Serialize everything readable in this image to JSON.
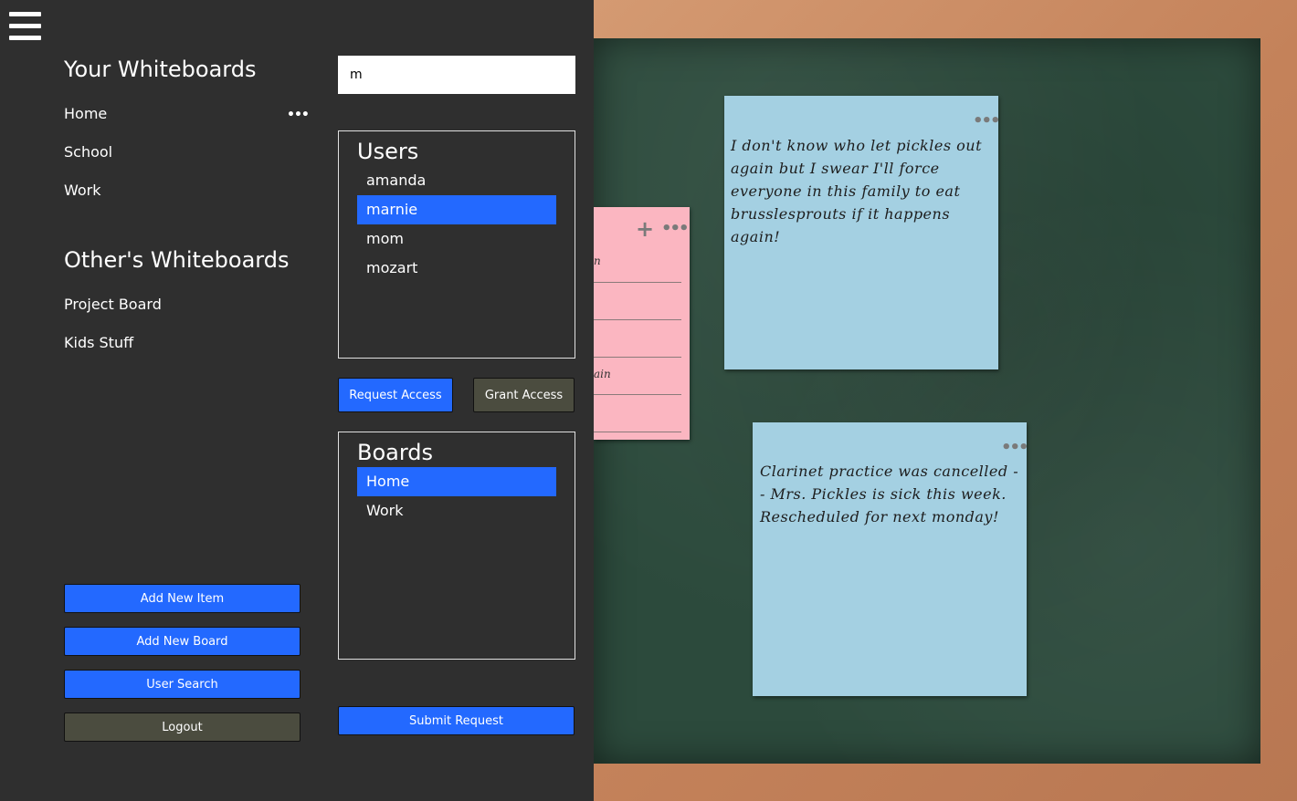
{
  "sidebar": {
    "your_title": "Your Whiteboards",
    "your_boards": [
      "Home",
      "School",
      "Work"
    ],
    "home_menu": "•••",
    "others_title": "Other's Whiteboards",
    "others_boards": [
      "Project Board",
      "Kids Stuff"
    ],
    "buttons": {
      "add_item": "Add New Item",
      "add_board": "Add New Board",
      "user_search": "User Search",
      "logout": "Logout"
    }
  },
  "search": {
    "value": "m"
  },
  "users_panel": {
    "title": "Users",
    "items": [
      "amanda",
      "marnie",
      "mom",
      "mozart"
    ],
    "selected": "marnie"
  },
  "access_buttons": {
    "request": "Request Access",
    "grant": "Grant Access"
  },
  "boards_panel": {
    "title": "Boards",
    "items": [
      "Home",
      "Work"
    ],
    "selected": "Home"
  },
  "submit_label": "Submit Request",
  "notes": {
    "pink": {
      "add": "+",
      "menu": "•••",
      "fragments": [
        "n",
        "ain"
      ]
    },
    "blue1": {
      "menu": "•••",
      "text": "I don't know who let pickles out again but I swear I'll force everyone in this family to eat brusslesprouts if it happens again!"
    },
    "blue2": {
      "menu": "•••",
      "text": "Clarinet practice was cancelled -- Mrs. Pickles is sick this week. Rescheduled for next monday!"
    }
  },
  "colors": {
    "accent": "#2369ff",
    "secondary_button": "#4b4c3f",
    "sidebar_bg": "#2f2f2f",
    "chalkboard": "#2c4a3c",
    "frame": "#c4825a",
    "note_blue": "#a4d0e2",
    "note_pink": "#fbb6c1"
  }
}
